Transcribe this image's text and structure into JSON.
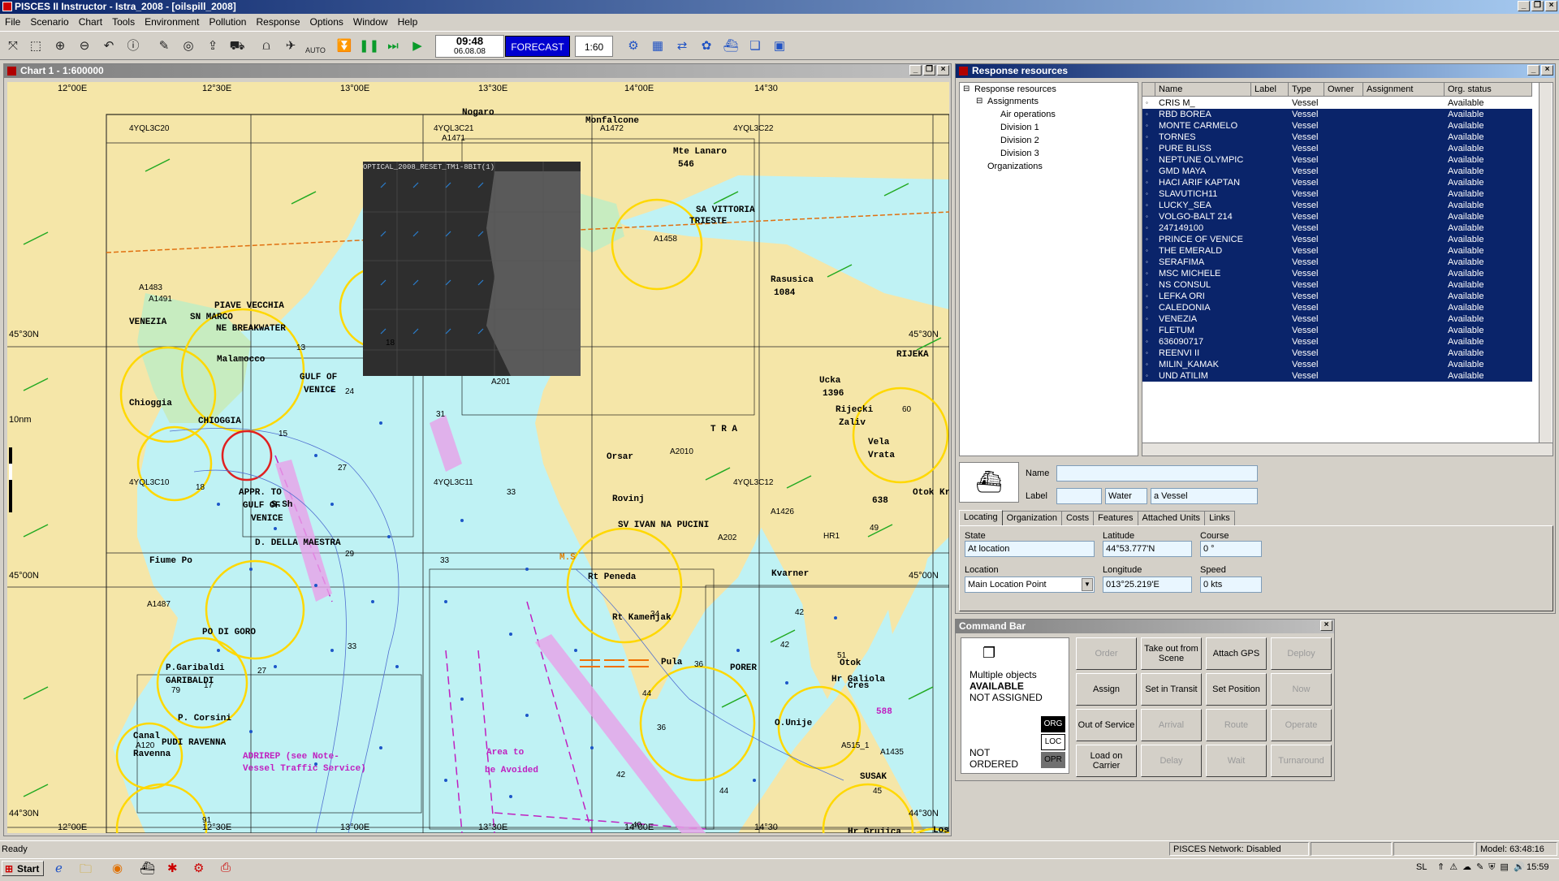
{
  "app": {
    "title": "PISCES II Instructor - Istra_2008 - [oilspill_2008]"
  },
  "menu": [
    "File",
    "Scenario",
    "Chart",
    "Tools",
    "Environment",
    "Pollution",
    "Response",
    "Options",
    "Window",
    "Help"
  ],
  "toolbar": {
    "time": "09:48",
    "date": "06.08.08",
    "forecast": "FORECAST",
    "step": "1:60",
    "auto": "AUTO"
  },
  "chart": {
    "title": "Chart 1 - 1:600000",
    "top_ticks": [
      "12°00E",
      "12°30E",
      "13°00E",
      "13°30E",
      "14°00E",
      "14°30"
    ],
    "bottom_ticks": [
      "12°00E",
      "12°30E",
      "13°00E",
      "13°30E",
      "14°00E",
      "14°30"
    ],
    "lat_left": [
      "45°30N",
      "45°00N",
      "44°30N"
    ],
    "lat_right": [
      "45°30N",
      "45°00N",
      "44°30N"
    ],
    "scale": "10nm",
    "places": [
      "Nogaro",
      "Monfalcone",
      "Mte Lanaro",
      "546",
      "TRIESTE",
      "SA VITTORIA",
      "Rasusica",
      "1084",
      "PIAVE VECCHIA",
      "VENEZIA",
      "NE BREAKWATER",
      "SN MARCO",
      "Malamocco",
      "GULF OF",
      "VENICE",
      "CHIOGGIA",
      "Chioggia",
      "APPR. TO",
      "GULF OF",
      "VENICE",
      "D. DELLA MAESTRA",
      "Fiume Po",
      "PO DI GORO",
      "P.Garibaldi",
      "GARIBALDI",
      "P. Corsini",
      "PUDI RAVENNA",
      "Canal",
      "Ravenna",
      "Ucka",
      "1396",
      "Rijecki",
      "Zaliv",
      "RIJEKA",
      "Vela",
      "Vrata",
      "Otok Kr",
      "Rovinj",
      "SV IVAN NA PUCINI",
      "Rt Peneda",
      "Rt Kamenjak",
      "Pula",
      "PORER",
      "Kvarner",
      "Hr Galiola",
      "O.Unije",
      "Otok",
      "Cres",
      "SUSAK",
      "Los",
      "Hr Grujica",
      "Orsar",
      "T R A",
      "638",
      "588",
      "ADRIREP (see Note-",
      "Vessel Traffic Service)",
      "Area to",
      "be Avoided",
      "M.S",
      "S.Sh",
      "OPTICAL_2008_RESET_TM1-8BIT(1)"
    ],
    "depths": [
      "13",
      "18",
      "24",
      "31",
      "27",
      "18",
      "33",
      "29",
      "33",
      "34",
      "36",
      "44",
      "42",
      "44",
      "42",
      "40",
      "45",
      "49",
      "51",
      "60",
      "42",
      "33",
      "27",
      "17",
      "79",
      "91",
      "15",
      "36"
    ],
    "cells": [
      "4YQL3C20",
      "4YQL3C21",
      "4YQL3C22",
      "4YQL3C10",
      "4YQL3C11",
      "4YQL3C12",
      "A1471",
      "A1472",
      "A1483",
      "A1491",
      "A1487",
      "A120",
      "A201",
      "A202",
      "A1426",
      "A1458",
      "A2010",
      "A1435",
      "HR1",
      "A515_1"
    ]
  },
  "rr": {
    "title": "Response resources",
    "tree": [
      "Response resources",
      "Assignments",
      "Air operations",
      "Division 1",
      "Division 2",
      "Division 3",
      "Organizations"
    ],
    "columns": [
      "Name",
      "Label",
      "Type",
      "Owner",
      "Assignment",
      "Org. status"
    ],
    "rows": [
      {
        "name": "CRIS M_",
        "type": "Vessel",
        "status": "Available",
        "sel": false
      },
      {
        "name": "RBD BOREA",
        "type": "Vessel",
        "status": "Available",
        "sel": true
      },
      {
        "name": "MONTE CARMELO",
        "type": "Vessel",
        "status": "Available",
        "sel": true
      },
      {
        "name": "TORNES",
        "type": "Vessel",
        "status": "Available",
        "sel": true
      },
      {
        "name": "PURE BLISS",
        "type": "Vessel",
        "status": "Available",
        "sel": true
      },
      {
        "name": "NEPTUNE OLYMPIC",
        "type": "Vessel",
        "status": "Available",
        "sel": true
      },
      {
        "name": "GMD MAYA",
        "type": "Vessel",
        "status": "Available",
        "sel": true
      },
      {
        "name": "HACI ARIF KAPTAN",
        "type": "Vessel",
        "status": "Available",
        "sel": true
      },
      {
        "name": "SLAVUTICH11",
        "type": "Vessel",
        "status": "Available",
        "sel": true
      },
      {
        "name": "LUCKY_SEA",
        "type": "Vessel",
        "status": "Available",
        "sel": true
      },
      {
        "name": "VOLGO-BALT 214",
        "type": "Vessel",
        "status": "Available",
        "sel": true
      },
      {
        "name": "247149100",
        "type": "Vessel",
        "status": "Available",
        "sel": true
      },
      {
        "name": "PRINCE OF VENICE",
        "type": "Vessel",
        "status": "Available",
        "sel": true
      },
      {
        "name": "THE EMERALD",
        "type": "Vessel",
        "status": "Available",
        "sel": true
      },
      {
        "name": "SERAFIMA",
        "type": "Vessel",
        "status": "Available",
        "sel": true
      },
      {
        "name": "MSC MICHELE",
        "type": "Vessel",
        "status": "Available",
        "sel": true
      },
      {
        "name": "NS CONSUL",
        "type": "Vessel",
        "status": "Available",
        "sel": true
      },
      {
        "name": "LEFKA ORI",
        "type": "Vessel",
        "status": "Available",
        "sel": true
      },
      {
        "name": "CALEDONIA",
        "type": "Vessel",
        "status": "Available",
        "sel": true
      },
      {
        "name": "VENEZIA",
        "type": "Vessel",
        "status": "Available",
        "sel": true
      },
      {
        "name": "FLETUM",
        "type": "Vessel",
        "status": "Available",
        "sel": true
      },
      {
        "name": "636090717",
        "type": "Vessel",
        "status": "Available",
        "sel": true
      },
      {
        "name": "REENVI II",
        "type": "Vessel",
        "status": "Available",
        "sel": true
      },
      {
        "name": "MILIN_KAMAK",
        "type": "Vessel",
        "status": "Available",
        "sel": true
      },
      {
        "name": "UND ATILIM",
        "type": "Vessel",
        "status": "Available",
        "sel": true
      }
    ],
    "props": {
      "name_label": "Name",
      "label_label": "Label",
      "water": "Water",
      "kind": "a Vessel",
      "tabs": [
        "Locating",
        "Organization",
        "Costs",
        "Features",
        "Attached Units",
        "Links"
      ],
      "state_label": "State",
      "state": "At location",
      "lat_label": "Latitude",
      "lat": "44°53.777'N",
      "course_label": "Course",
      "course": "0 °",
      "loc_label": "Location",
      "loc": "Main Location Point",
      "lon_label": "Longitude",
      "lon": "013°25.219'E",
      "speed_label": "Speed",
      "speed": "0 kts"
    }
  },
  "cmd": {
    "title": "Command Bar",
    "line1": "Multiple objects",
    "line2": "AVAILABLE",
    "line3": "NOT ASSIGNED",
    "line4": "NOT",
    "line5": "ORDERED",
    "badges": [
      "ORG",
      "LOC",
      "OPR"
    ],
    "buttons": [
      {
        "label": "Order",
        "enabled": false
      },
      {
        "label": "Take out from Scene",
        "enabled": true
      },
      {
        "label": "Attach GPS",
        "enabled": true
      },
      {
        "label": "Deploy",
        "enabled": false
      },
      {
        "label": "Assign",
        "enabled": true
      },
      {
        "label": "Set in Transit",
        "enabled": true
      },
      {
        "label": "Set Position",
        "enabled": true
      },
      {
        "label": "Now",
        "enabled": false
      },
      {
        "label": "Out of Service",
        "enabled": true
      },
      {
        "label": "Arrival",
        "enabled": false
      },
      {
        "label": "Route",
        "enabled": false
      },
      {
        "label": "Operate",
        "enabled": false
      },
      {
        "label": "Load on Carrier",
        "enabled": true
      },
      {
        "label": "Delay",
        "enabled": false
      },
      {
        "label": "Wait",
        "enabled": false
      },
      {
        "label": "Turnaround",
        "enabled": false
      }
    ]
  },
  "status": {
    "ready": "Ready",
    "network": "PISCES Network: Disabled",
    "model": "Model: 63:48:16"
  },
  "taskbar": {
    "start": "Start",
    "lang": "SL",
    "time": "15:59"
  },
  "colors": {
    "sea": "#bff2f4",
    "land": "#f5e6a8",
    "selection": "#0a246a",
    "forecast": "#0000d0"
  }
}
